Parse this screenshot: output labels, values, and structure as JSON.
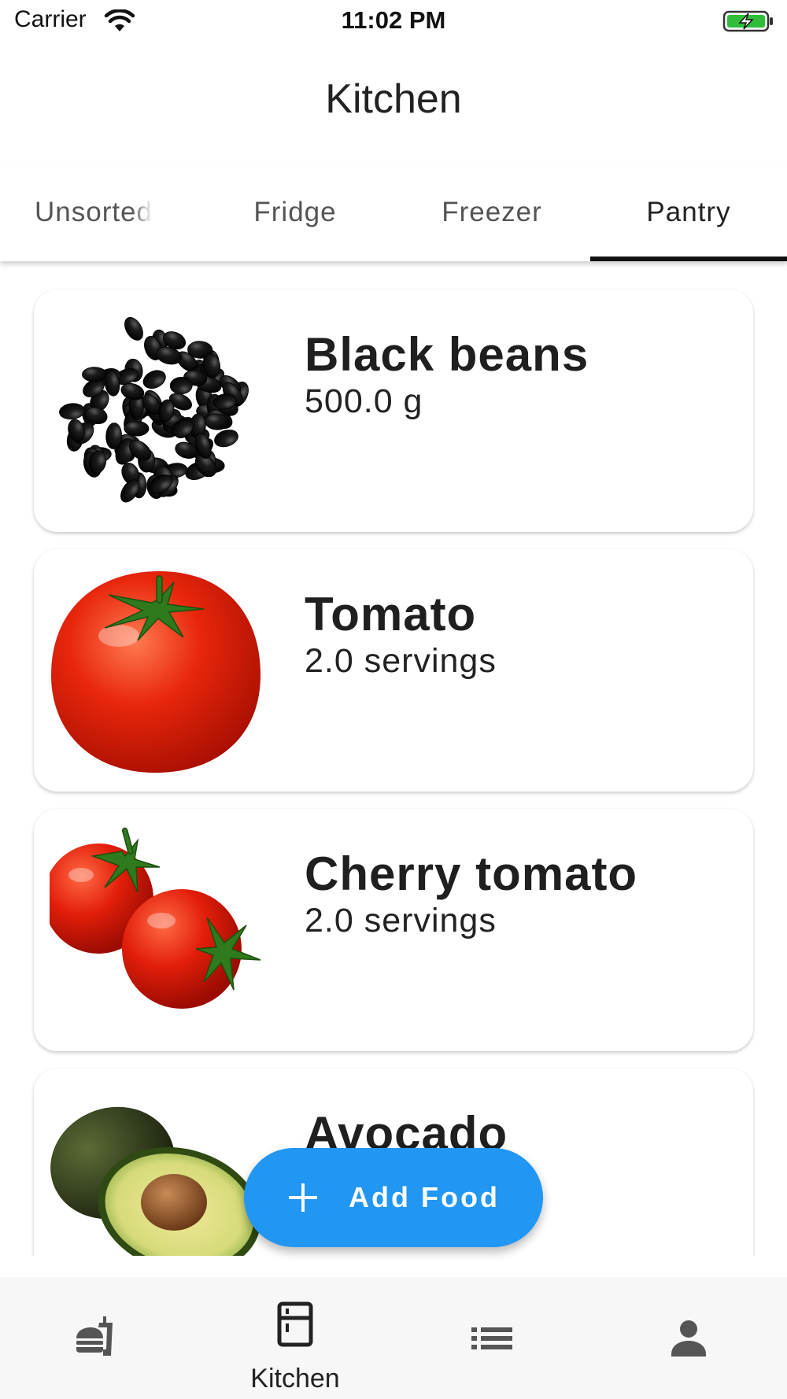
{
  "status_bar": {
    "carrier": "Carrier",
    "time": "11:02 PM",
    "battery_color": "#2fbd3a"
  },
  "app_bar": {
    "title": "Kitchen"
  },
  "tabs": [
    {
      "label": "Unsorted",
      "selected": false
    },
    {
      "label": "Fridge",
      "selected": false
    },
    {
      "label": "Freezer",
      "selected": false
    },
    {
      "label": "Pantry",
      "selected": true
    }
  ],
  "food_items": [
    {
      "name": "Black beans",
      "amount": "500.0 g",
      "image_icon": "black-beans-image"
    },
    {
      "name": "Tomato",
      "amount": "2.0 servings",
      "image_icon": "tomato-image"
    },
    {
      "name": "Cherry tomato",
      "amount": "2.0 servings",
      "image_icon": "cherry-tomato-image"
    },
    {
      "name": "Avocado",
      "amount": "",
      "image_icon": "avocado-image"
    }
  ],
  "fab": {
    "label": "Add Food",
    "icon": "plus-icon",
    "color": "#2196F3"
  },
  "bottom_nav": [
    {
      "icon": "fastfood-icon",
      "label": "",
      "selected": false
    },
    {
      "icon": "kitchen-icon",
      "label": "Kitchen",
      "selected": true
    },
    {
      "icon": "list-icon",
      "label": "",
      "selected": false
    },
    {
      "icon": "person-icon",
      "label": "",
      "selected": false
    }
  ]
}
